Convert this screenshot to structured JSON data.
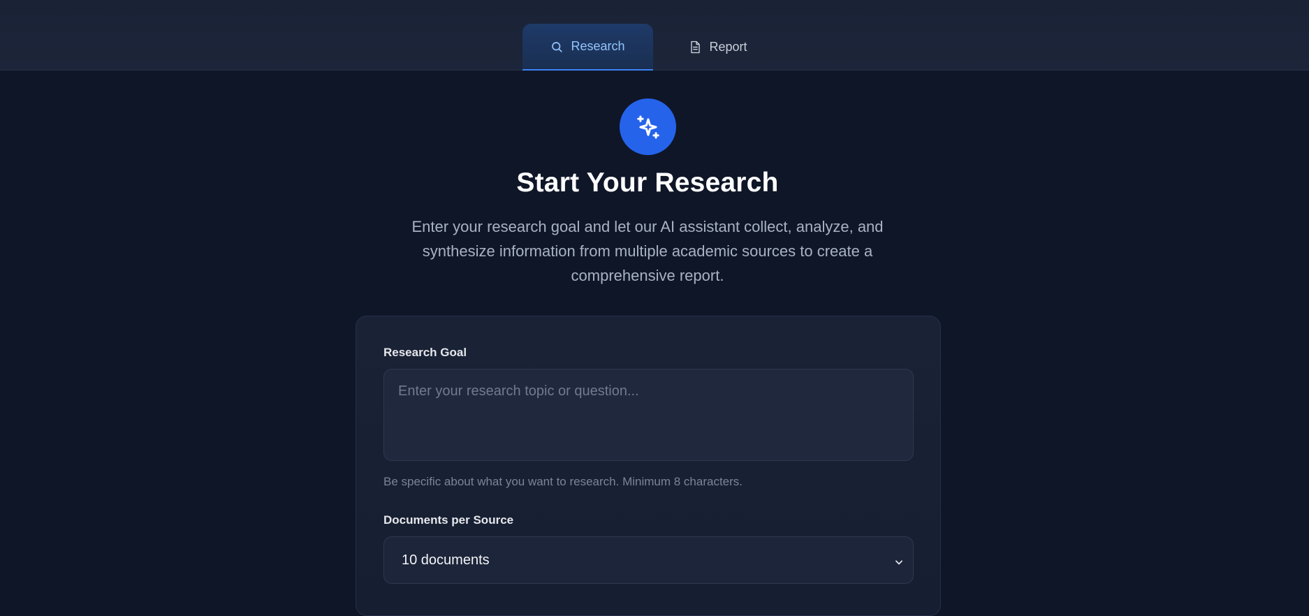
{
  "tabs": [
    {
      "label": "Research",
      "icon": "search-icon",
      "active": true
    },
    {
      "label": "Report",
      "icon": "document-icon",
      "active": false
    }
  ],
  "hero": {
    "icon": "sparkles-icon",
    "title": "Start Your Research",
    "subtitle": "Enter your research goal and let our AI assistant collect, analyze, and synthesize information from multiple academic sources to create a comprehensive report."
  },
  "form": {
    "goal_label": "Research Goal",
    "goal_placeholder": "Enter your research topic or question...",
    "goal_value": "",
    "goal_hint": "Be specific about what you want to research. Minimum 8 characters.",
    "docs_label": "Documents per Source",
    "docs_selected": "10 documents"
  },
  "colors": {
    "background": "#0f1628",
    "accent": "#2563eb",
    "active_tab_text": "#93c5fd",
    "card": "#1a2236"
  }
}
